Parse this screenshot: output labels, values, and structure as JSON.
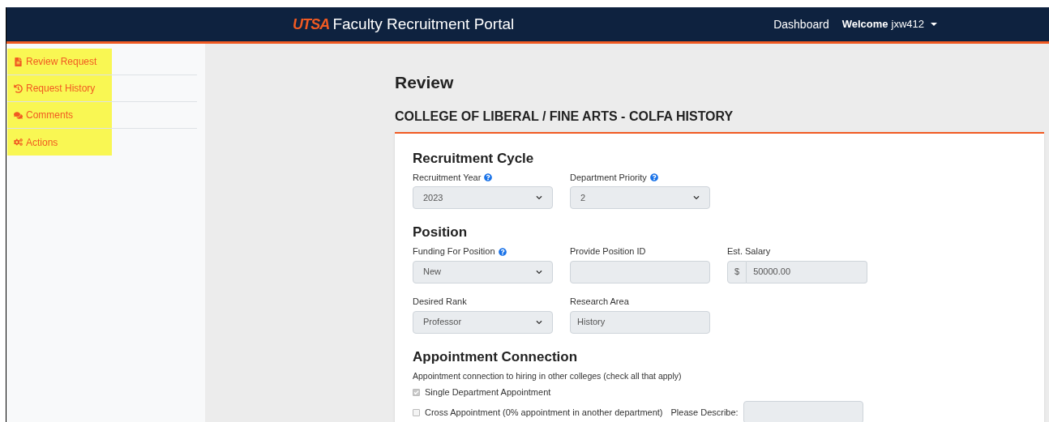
{
  "navbar": {
    "logo": "UTSA",
    "title": "Faculty Recruitment Portal",
    "links": [
      {
        "label": "Dashboard"
      }
    ],
    "user_menu": {
      "greeting": "Welcome",
      "user": "jxw412"
    }
  },
  "sidebar": {
    "items": [
      {
        "label": "Review Request",
        "highlighted": true
      },
      {
        "label": "Request History",
        "highlighted": true
      },
      {
        "label": "Comments",
        "highlighted": true
      },
      {
        "label": "Actions",
        "highlighted": true
      }
    ]
  },
  "page": {
    "title": "Review",
    "subtitle": "COLLEGE OF LIBERAL / FINE ARTS - COLFA HISTORY"
  },
  "sections": [
    {
      "title": "Recruitment Cycle",
      "rows": [
        [
          {
            "kind": "select",
            "label": "Recruitment Year",
            "help": true,
            "value": "2023"
          },
          {
            "kind": "select",
            "label": "Department Priority",
            "help": true,
            "value": "2"
          }
        ]
      ]
    },
    {
      "title": "Position",
      "rows": [
        [
          {
            "kind": "select",
            "label": "Funding For Position",
            "help": true,
            "value": "New"
          },
          {
            "kind": "input",
            "label": "Provide Position ID",
            "help": false
          },
          {
            "kind": "money",
            "label": "Est. Salary",
            "help": false,
            "prefix": "$",
            "value": "50000.00"
          }
        ],
        [
          {
            "kind": "select",
            "label": "Desired Rank",
            "help": false,
            "value": "Professor"
          },
          {
            "kind": "input",
            "label": "Research Area",
            "help": false,
            "value": "History"
          }
        ]
      ]
    },
    {
      "title": "Appointment Connection",
      "note": "Appointment connection to hiring in other colleges (check all that apply)",
      "checkboxes": [
        {
          "label": "Single Department Appointment",
          "checked": true
        },
        {
          "label": "Cross Appointment (0% appointment in another department)",
          "checked": false,
          "extra_label": "Please Describe:"
        }
      ]
    }
  ]
}
